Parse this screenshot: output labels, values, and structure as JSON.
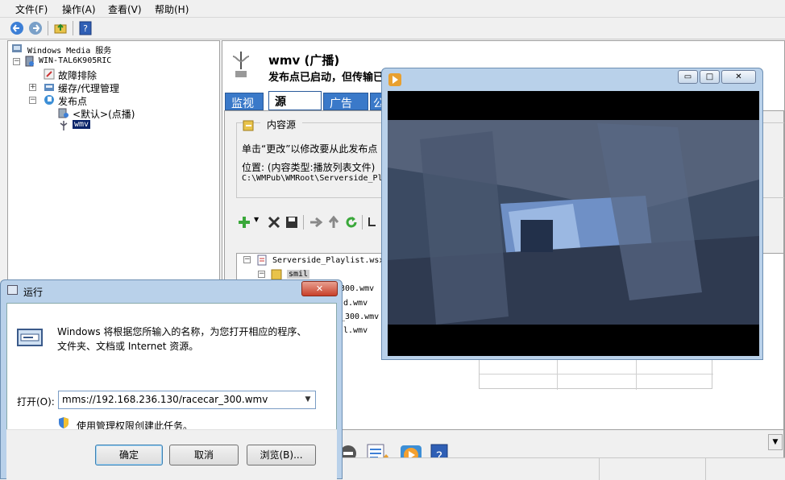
{
  "menu": {
    "file": "文件(F)",
    "action": "操作(A)",
    "view": "查看(V)",
    "help": "帮助(H)"
  },
  "tree": {
    "root": "Windows Media 服务",
    "server": "WIN-TAL6K905RIC",
    "troubleshoot": "故障排除",
    "cache": "缓存/代理管理",
    "pubpoints": "发布点",
    "default_point": "<默认>(点播)",
    "wmv_point": "wmv"
  },
  "detail": {
    "title": "wmv (广播)",
    "subtitle": "发布点已启动，但传输已",
    "tabs": [
      "监视",
      "源",
      "广告",
      "公"
    ],
    "content_source_label": "内容源",
    "change_hint": "单击“更改”以修改要从此发布点",
    "location_label": "位置: (内容类型:播放列表文件)",
    "location_path": "C:\\WMPub\\WMRoot\\Serverside_Pl",
    "playlist": {
      "root": "Serverside_Playlist.wsx",
      "smil": "smil",
      "items": [
        "300.wmv",
        "d.wmv",
        "_300.wmv",
        "l.wmv"
      ]
    }
  },
  "player": {
    "minimize": "▭",
    "maximize": "□",
    "close": "✕"
  },
  "run_dialog": {
    "title": "运行",
    "close": "✕",
    "description_line1": "Windows 将根据您所输入的名称，为您打开相应的程序、",
    "description_line2": "文件夹、文档或 Internet 资源。",
    "open_label": "打开(O):",
    "open_value": "mms://192.168.236.130/racecar_300.wmv",
    "admin_note": "使用管理权限创建此任务。",
    "ok": "确定",
    "cancel": "取消",
    "browse": "浏览(B)..."
  }
}
